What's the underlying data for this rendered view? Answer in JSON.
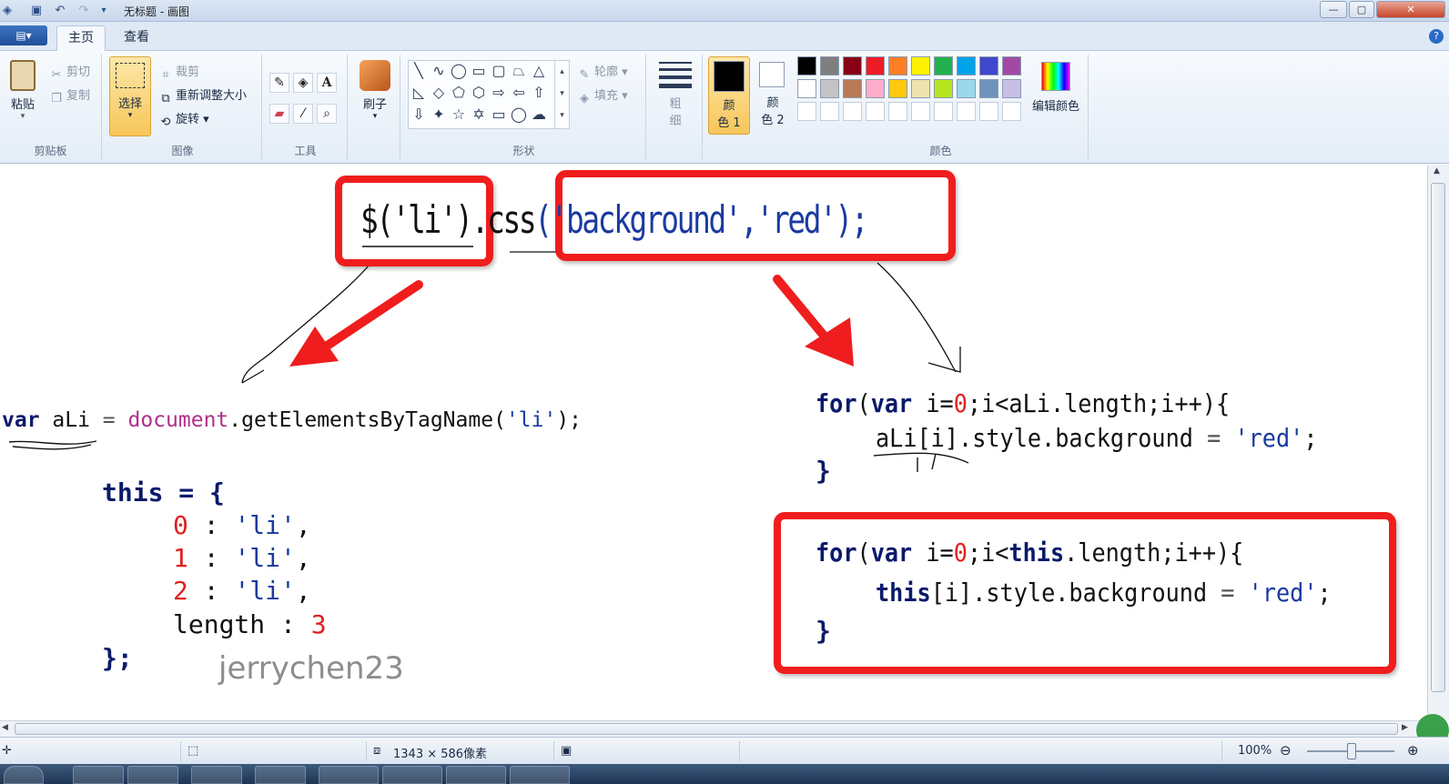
{
  "window": {
    "title": "无标题 - 画图",
    "controls": {
      "minimize": "—",
      "maximize": "▢",
      "close": "✕"
    }
  },
  "menu": {
    "app_button": "▤▾",
    "tabs": [
      {
        "label": "主页",
        "active": true
      },
      {
        "label": "查看",
        "active": false
      }
    ],
    "help": "?"
  },
  "ribbon": {
    "clipboard": {
      "label": "剪贴板",
      "paste": "粘贴",
      "cut": "剪切",
      "copy": "复制"
    },
    "image": {
      "label": "图像",
      "select": "选择",
      "crop": "裁剪",
      "resize": "重新调整大小",
      "rotate": "旋转"
    },
    "tools": {
      "label": "工具"
    },
    "brush": {
      "label": "刷子"
    },
    "shapes": {
      "label": "形状",
      "outline": "轮廓",
      "fill": "填充"
    },
    "size": {
      "label_top": "粗",
      "label_bottom": "细"
    },
    "color1": {
      "label_top": "颜",
      "label_bottom": "色 1",
      "color": "#000000"
    },
    "color2": {
      "label_top": "颜",
      "label_bottom": "色 2",
      "color": "#ffffff"
    },
    "colors": {
      "label": "颜色",
      "edit": "编辑颜色",
      "palette_row1": [
        "#000000",
        "#7f7f7f",
        "#880015",
        "#ed1c24",
        "#ff7f27",
        "#fff200",
        "#22b14c",
        "#00a2e8",
        "#3f48cc",
        "#a349a4"
      ],
      "palette_row2": [
        "#ffffff",
        "#c3c3c3",
        "#b97a57",
        "#ffaec9",
        "#ffc90e",
        "#efe4b0",
        "#b5e61d",
        "#99d9ea",
        "#7092be",
        "#c8bfe7"
      ]
    }
  },
  "canvas": {
    "top_code": {
      "part1": "$('li')",
      "part2": ".css",
      "part3": "('background','red');"
    },
    "left_code": {
      "line1_kw": "var",
      "line1_var": " aLi ",
      "line1_eq": "=",
      "line1_obj": " document",
      "line1_rest": ".getElementsByTagName(",
      "line1_str": "'li'",
      "line1_end": ");",
      "this_kw": "this",
      "this_rest": " = {",
      "rows": [
        {
          "num": "0",
          "sep": " : ",
          "str": "'li'",
          "end": ","
        },
        {
          "num": "1",
          "sep": " : ",
          "str": "'li'",
          "end": ","
        },
        {
          "num": "2",
          "sep": " : ",
          "str": "'li'",
          "end": ","
        }
      ],
      "length_key": "length",
      "length_sep": " : ",
      "length_val": "3",
      "close": "};"
    },
    "right_code_1": {
      "for_kw": "for",
      "open": "(",
      "var_kw": "var",
      "init_a": " i=",
      "init_num": "0",
      "cond": ";i<aLi.length;i++){",
      "body_a": "aLi[i].style.background ",
      "body_eq": "=",
      "body_str": " 'red'",
      "body_end": ";",
      "close": "}"
    },
    "right_code_2": {
      "for_kw": "for",
      "open": "(",
      "var_kw": "var",
      "init_a": " i=",
      "init_num": "0",
      "cond_a": ";i<",
      "cond_kw": "this",
      "cond_b": ".length;i++){",
      "body_kw": "this",
      "body_a": "[i].style.background ",
      "body_eq": "=",
      "body_str": " 'red'",
      "body_end": ";",
      "close": "}"
    },
    "watermark": "jerrychen23"
  },
  "statusbar": {
    "size": "1343 × 586像素",
    "zoom": "100%"
  }
}
